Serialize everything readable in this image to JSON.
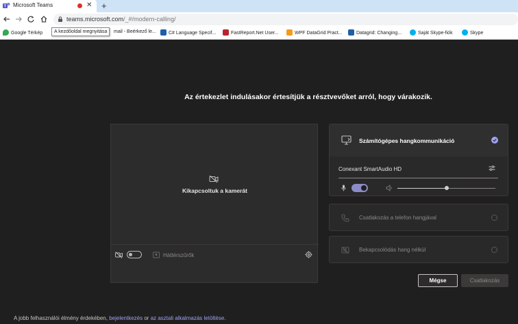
{
  "browser": {
    "tab_title": "Microsoft Teams",
    "tab_close_glyph": "✕",
    "new_tab_glyph": "+",
    "url_host": "teams.microsoft.com",
    "url_path": "/_#/modern-calling/",
    "tooltip": "A kezdőoldal megnyitása",
    "bookmarks": [
      {
        "label": "Google Térkép",
        "icon": "maps-icon",
        "color": "#34a853"
      },
      {
        "label": "mail - Beérkező le...",
        "icon": "mail-icon",
        "color": "#0078d4"
      },
      {
        "label": "C# Language Specif...",
        "icon": "doc-icon",
        "color": "#1f5fa8"
      },
      {
        "label": "FastReport.Net User...",
        "icon": "fastreport-icon",
        "color": "#b7262f"
      },
      {
        "label": "WPF DataGrid Pract...",
        "icon": "wpf-icon",
        "color": "#f29b1d"
      },
      {
        "label": "Datagrid: Changing...",
        "icon": "datagrid-icon",
        "color": "#1f5fa8"
      },
      {
        "label": "Saját Skype-fiók",
        "icon": "skype-icon",
        "color": "#00aff0"
      },
      {
        "label": "Skype",
        "icon": "skype-icon",
        "color": "#00aff0"
      }
    ]
  },
  "teams": {
    "heading": "Az értekezlet indulásakor értesítjük a résztvevőket arról, hogy várakozik.",
    "camera_off": "Kikapcsoltuk a kamerát",
    "background_filters": "Háttérszűrők",
    "audio": {
      "computer_audio": "Számítógépes hangkommunikáció",
      "device": "Conexant SmartAudio HD",
      "volume": 0.5,
      "phone_audio": "Csatlakozás a telefon hangjával",
      "no_audio": "Bekapcsolódás hang nélkül"
    },
    "cancel_button": "Mégse",
    "join_button": "Csatlakozás",
    "footer": {
      "text_before": "A jobb felhasználói élmény érdekében, ",
      "login_link": "bejelentkezés",
      "text_mid": " or ",
      "app_link": "az asztali alkalmazás letöltése",
      "text_after": "."
    }
  },
  "colors": {
    "accent": "#a0a1f0",
    "toggle_on": "#8b8cc7",
    "background": "#201f1f"
  }
}
